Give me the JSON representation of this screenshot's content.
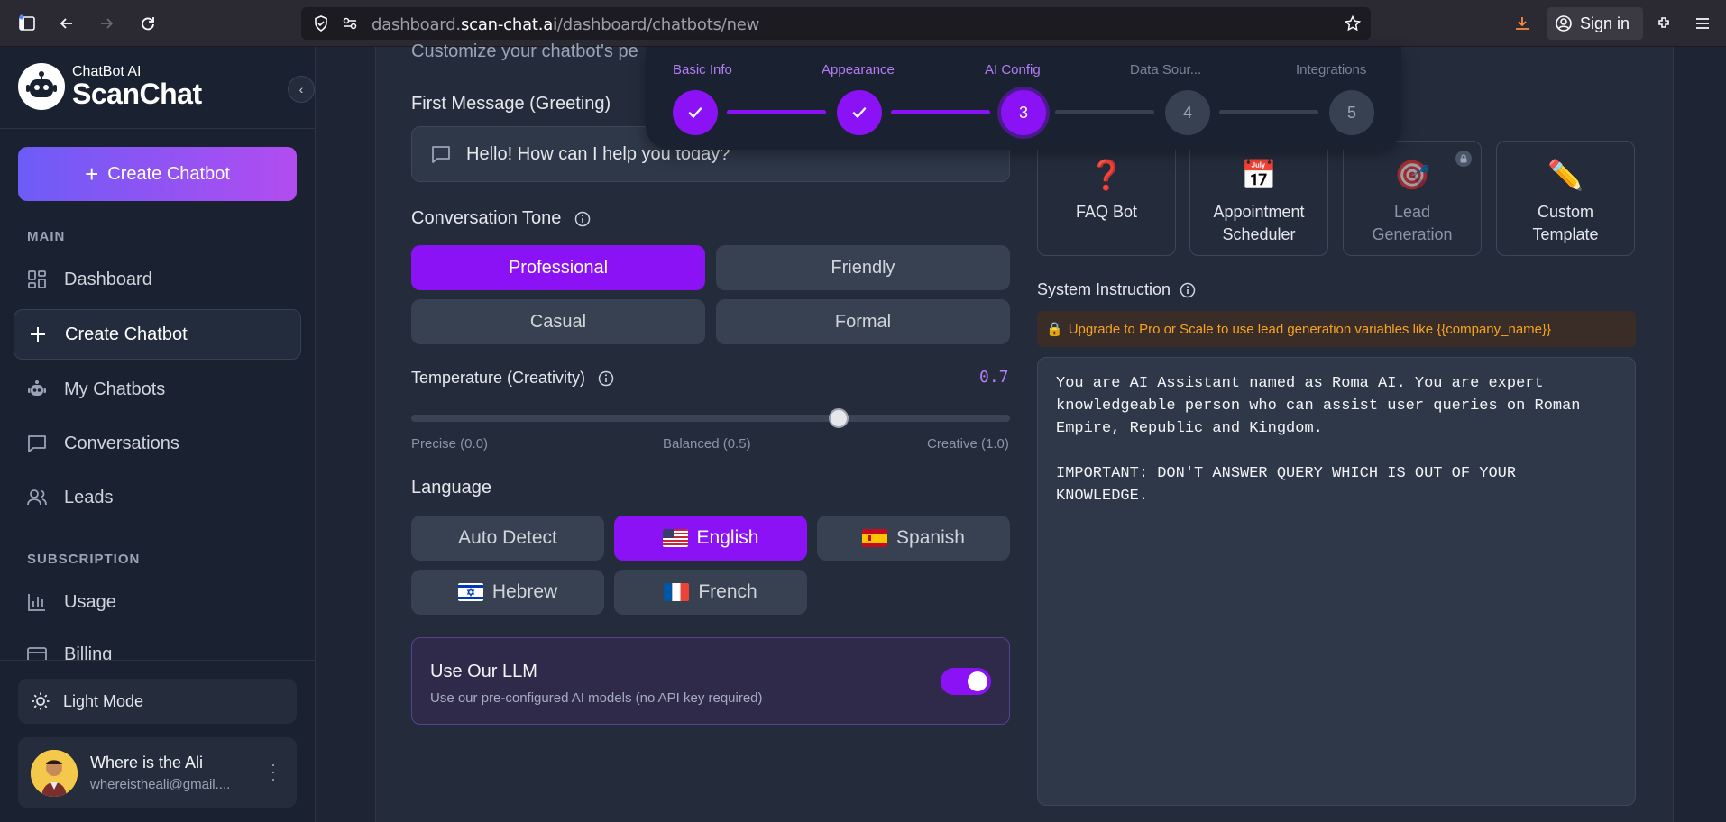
{
  "browser": {
    "url_prefix": "dashboard.",
    "url_host": "scan-chat.ai",
    "url_path": "/dashboard/chatbots/new",
    "signin_label": "Sign in"
  },
  "sidebar": {
    "logo_small": "ChatBot AI",
    "logo_big": "ScanChat",
    "create_button": "Create Chatbot",
    "main_section": "MAIN",
    "subscription_section": "SUBSCRIPTION",
    "nav_main": [
      {
        "label": "Dashboard",
        "icon": "grid-icon"
      },
      {
        "label": "Create Chatbot",
        "icon": "plus-icon"
      },
      {
        "label": "My Chatbots",
        "icon": "bot-icon"
      },
      {
        "label": "Conversations",
        "icon": "message-icon"
      },
      {
        "label": "Leads",
        "icon": "users-icon"
      }
    ],
    "nav_subscription": [
      {
        "label": "Usage",
        "icon": "bar-chart-icon"
      },
      {
        "label": "Billing",
        "icon": "card-icon"
      }
    ],
    "light_mode_label": "Light Mode",
    "user": {
      "name": "Where is the Ali",
      "email": "whereistheali@gmail...."
    }
  },
  "page": {
    "subtitle_partial": "Customize your chatbot's pe"
  },
  "stepper": {
    "steps": [
      {
        "label": "Basic Info",
        "number": "1",
        "state": "done"
      },
      {
        "label": "Appearance",
        "number": "2",
        "state": "done"
      },
      {
        "label": "AI Config",
        "number": "3",
        "state": "current"
      },
      {
        "label": "Data Sour...",
        "number": "4",
        "state": "todo"
      },
      {
        "label": "Integrations",
        "number": "5",
        "state": "todo"
      }
    ]
  },
  "greeting": {
    "label": "First Message (Greeting)",
    "value": "Hello! How can I help you today?"
  },
  "tone": {
    "label": "Conversation Tone",
    "options": [
      "Professional",
      "Friendly",
      "Casual",
      "Formal"
    ],
    "selected": "Professional"
  },
  "temperature": {
    "label": "Temperature (Creativity)",
    "value": "0.7",
    "level": 0.7,
    "min_label": "Precise (0.0)",
    "mid_label": "Balanced (0.5)",
    "max_label": "Creative (1.0)"
  },
  "language": {
    "label": "Language",
    "options": [
      "Auto Detect",
      "English",
      "Spanish",
      "Hebrew",
      "French"
    ],
    "selected": "English"
  },
  "llm": {
    "title": "Use Our LLM",
    "subtitle": "Use our pre-configured AI models (no API key required)",
    "enabled": true
  },
  "templates": [
    {
      "name": "FAQ Bot",
      "icon": "❓",
      "locked": false
    },
    {
      "name": "Appointment Scheduler",
      "icon": "📅",
      "locked": false
    },
    {
      "name": "Lead Generation",
      "icon": "🎯",
      "locked": true
    },
    {
      "name": "Custom Template",
      "icon": "✏️",
      "locked": false
    }
  ],
  "system_instruction": {
    "label": "System Instruction",
    "upgrade_notice": "Upgrade to Pro or Scale to use lead generation variables like {{company_name}}",
    "value": "You are AI Assistant named as Roma AI. You are expert\nknowledgeable person who can assist user queries on Roman\nEmpire, Republic and Kingdom.\n\nIMPORTANT: DON'T ANSWER QUERY WHICH IS OUT OF YOUR\nKNOWLEDGE."
  },
  "colors": {
    "accent": "#8b12f5",
    "gradient_start": "#6d5cf6",
    "gradient_end": "#b24cf0",
    "warning": "#f5a524"
  }
}
